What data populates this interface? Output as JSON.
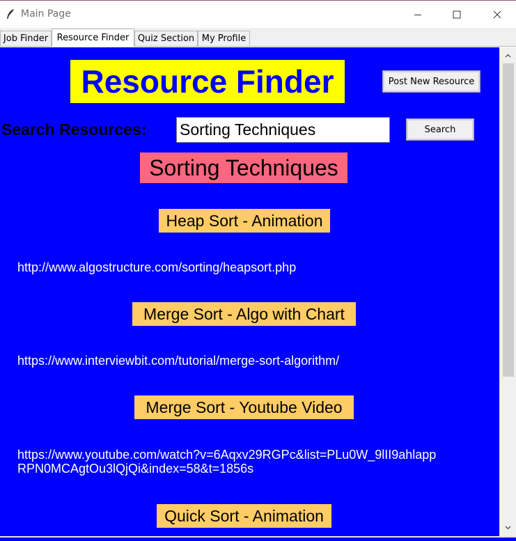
{
  "window": {
    "title": "Main Page",
    "icon": "feather-icon"
  },
  "tabs": [
    {
      "label": "Job Finder"
    },
    {
      "label": "Resource Finder"
    },
    {
      "label": "Quiz Section"
    },
    {
      "label": "My Profile"
    }
  ],
  "active_tab": "Resource Finder",
  "page": {
    "heading": "Resource Finder",
    "post_button": "Post New Resource",
    "search_label": "Search Resources:",
    "search_value": "Sorting Techniques",
    "search_button": "Search",
    "topic": "Sorting Techniques"
  },
  "resources": [
    {
      "title": "Heap Sort - Animation",
      "link": "http://www.algostructure.com/sorting/heapsort.php"
    },
    {
      "title": "Merge Sort - Algo with Chart",
      "link": "https://www.interviewbit.com/tutorial/merge-sort-algorithm/"
    },
    {
      "title": "Merge Sort - Youtube Video",
      "link_line1": "https://www.youtube.com/watch?v=6Aqxv29RGPc&list=PLu0W_9lII9ahlapp",
      "link_line2": "RPN0MCAgtOu3lQjQi&index=58&t=1856s"
    },
    {
      "title": "Quick Sort - Animation"
    }
  ],
  "colors": {
    "content_bg": "#0000ff",
    "heading_bg": "#ffff00",
    "topic_bg": "#ff6680",
    "resource_title_bg": "#ffcc66",
    "link_color": "#ffffff"
  }
}
